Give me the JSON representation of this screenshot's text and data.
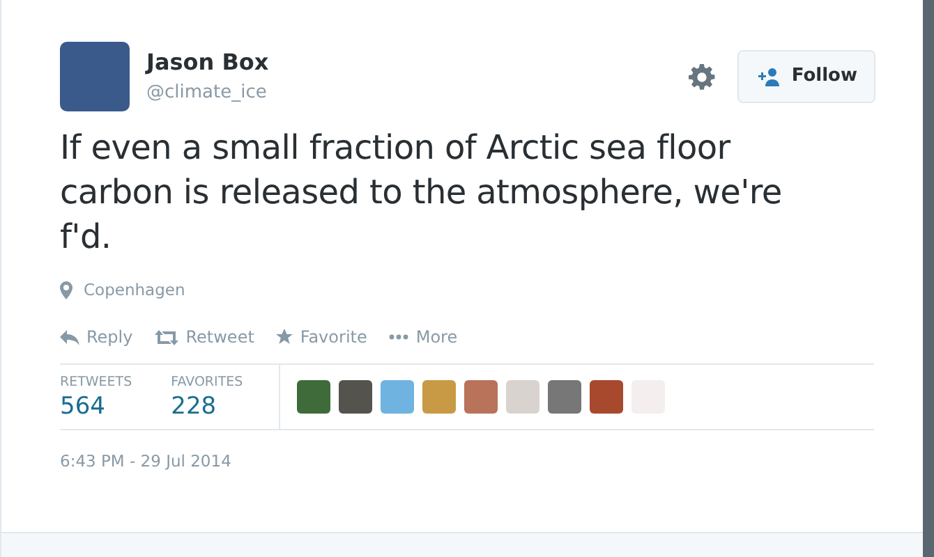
{
  "author": {
    "name": "Jason Box",
    "handle": "@climate_ice"
  },
  "follow_button": {
    "label": "Follow"
  },
  "tweet_text": "If even a small fraction of Arctic sea floor carbon is released to the atmosphere, we're f'd.",
  "location": "Copenhagen",
  "actions": [
    {
      "kind": "reply",
      "label": "Reply"
    },
    {
      "kind": "retweet",
      "label": "Retweet"
    },
    {
      "kind": "favorite",
      "label": "Favorite"
    },
    {
      "kind": "more",
      "label": "More"
    }
  ],
  "stats": [
    {
      "label": "RETWEETS",
      "value": "564"
    },
    {
      "label": "FAVORITES",
      "value": "228"
    }
  ],
  "favoriters": [
    {
      "color": "#3f6b3a"
    },
    {
      "color": "#55534e"
    },
    {
      "color": "#6fb3e0"
    },
    {
      "color": "#c99a45"
    },
    {
      "color": "#b8735a"
    },
    {
      "color": "#d9d3cf"
    },
    {
      "color": "#777777"
    },
    {
      "color": "#a8492e"
    },
    {
      "color": "#f4eeee"
    }
  ],
  "timestamp": "6:43 PM - 29 Jul 2014"
}
